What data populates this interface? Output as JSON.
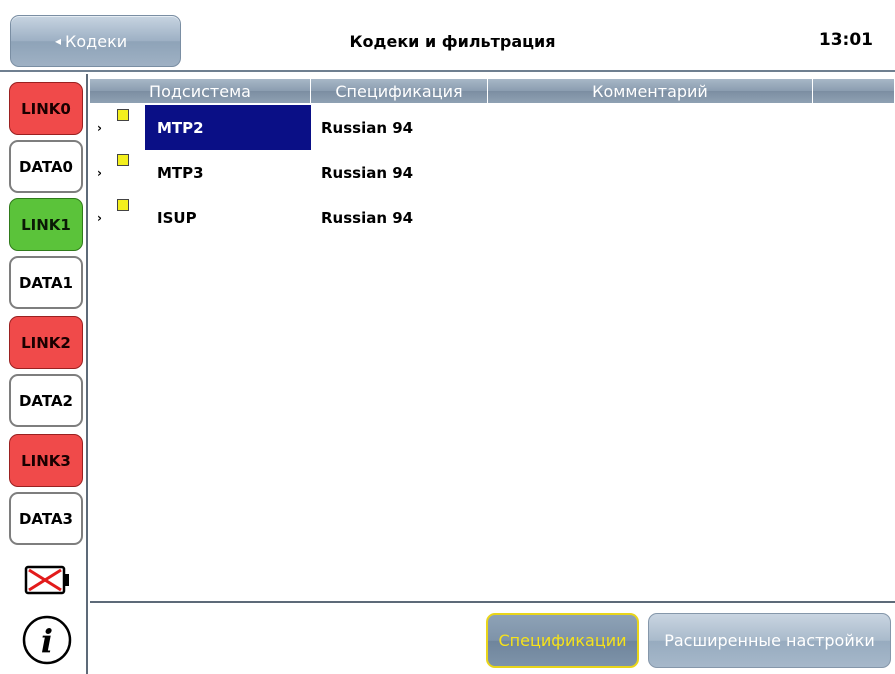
{
  "header": {
    "back_label": "Кодеки",
    "back_arrow": "◂",
    "title": "Кодеки и фильтрация",
    "time": "13:01"
  },
  "sidebar": {
    "buttons": [
      {
        "label": "LINK0",
        "color": "#f04a4a"
      },
      {
        "label": "DATA0",
        "color": "#ffffff"
      },
      {
        "label": "LINK1",
        "color": "#5bc33a"
      },
      {
        "label": "DATA1",
        "color": "#ffffff"
      },
      {
        "label": "LINK2",
        "color": "#f04a4a"
      },
      {
        "label": "DATA2",
        "color": "#ffffff"
      },
      {
        "label": "LINK3",
        "color": "#f04a4a"
      },
      {
        "label": "DATA3",
        "color": "#ffffff"
      }
    ],
    "battery_icon": "battery-empty-icon",
    "info_icon": "info-icon"
  },
  "table": {
    "columns": [
      "Подсистема",
      "Спецификация",
      "Комментарий",
      ""
    ],
    "rows": [
      {
        "subsystem": "MTP2",
        "specification": "Russian 94",
        "comment": "",
        "selected": true
      },
      {
        "subsystem": "MTP3",
        "specification": "Russian 94",
        "comment": "",
        "selected": false
      },
      {
        "subsystem": "ISUP",
        "specification": "Russian 94",
        "comment": "",
        "selected": false
      }
    ],
    "expander_glyph": "›",
    "status_color": "#f3ef1d",
    "selection_color": "#0a0f86"
  },
  "toolbar": {
    "spec_label": "Спецификации",
    "advanced_label": "Расширенные настройки",
    "spec_text_color": "#f6e21b"
  }
}
